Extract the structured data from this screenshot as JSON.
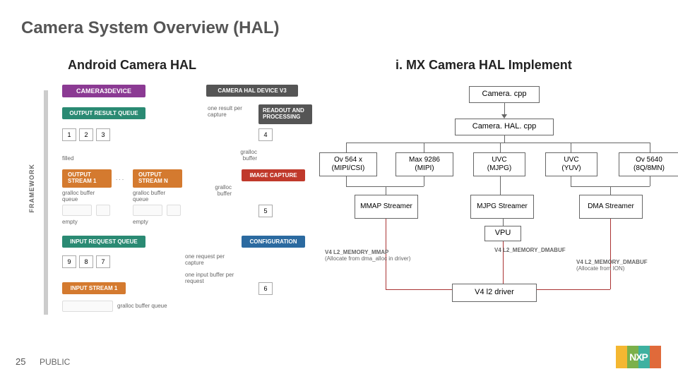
{
  "title": "Camera System Overview (HAL)",
  "columns": {
    "left_title": "Android Camera HAL",
    "right_title": "i. MX Camera HAL Implement"
  },
  "left": {
    "framework_label": "FRAMEWORK",
    "camera3device": "CAMERA3DEVICE",
    "camera_hal_device_v3": "CAMERA HAL DEVICE V3",
    "output_result_queue": "OUTPUT RESULT QUEUE",
    "readout_and_processing": "READOUT AND PROCESSING",
    "one_result_per_capture": "one result per capture",
    "cells_123": [
      "1",
      "2",
      "3"
    ],
    "cell_4": "4",
    "filled": "filled",
    "gralloc_buffer_top": "gralloc buffer",
    "output_stream_1": "OUTPUT STREAM 1",
    "output_stream_n": "OUTPUT STREAM N",
    "image_capture": "IMAGE CAPTURE",
    "gralloc_buffer_queue": "gralloc buffer queue",
    "gralloc_buffer_mid": "gralloc buffer",
    "ellipsis": ". . .",
    "empty": "empty",
    "cell_5": "5",
    "input_request_queue": "INPUT REQUEST QUEUE",
    "configuration": "CONFIGURATION",
    "cells_987": [
      "9",
      "8",
      "7"
    ],
    "one_request_per_capture": "one request per capture",
    "one_input_buffer_per_request": "one input buffer per request",
    "input_stream_1": "INPUT STREAM 1",
    "cell_6": "6",
    "gralloc_buffer_queue_bottom": "gralloc buffer queue"
  },
  "right": {
    "camera_cpp": "Camera. cpp",
    "camera_hal_cpp": "Camera. HAL. cpp",
    "sensors": [
      {
        "name": "Ov 564 x",
        "sub": "(MIPI/CSI)"
      },
      {
        "name": "Max 9286",
        "sub": "(MIPI)"
      },
      {
        "name": "UVC",
        "sub": "(MJPG)"
      },
      {
        "name": "UVC",
        "sub": "(YUV)"
      },
      {
        "name": "Ov 5640",
        "sub": "(8Q/8MN)"
      }
    ],
    "streamers": [
      "MMAP Streamer",
      "MJPG Streamer",
      "DMA Streamer"
    ],
    "vpu": "VPU",
    "mem_mmap": {
      "title": "V4 L2_MEMORY_MMAP",
      "sub": "(Allocate from dma_alloc in driver)"
    },
    "mem_dmabuf1": {
      "title": "V4 L2_MEMORY_DMABUF",
      "sub": ""
    },
    "mem_dmabuf2": {
      "title": "V4 L2_MEMORY_DMABUF",
      "sub": "(Allocate from ION)"
    },
    "v4l2_driver": "V4 l2 driver"
  },
  "footer": {
    "page": "25",
    "public": "PUBLIC"
  },
  "logo_text": "NXP"
}
